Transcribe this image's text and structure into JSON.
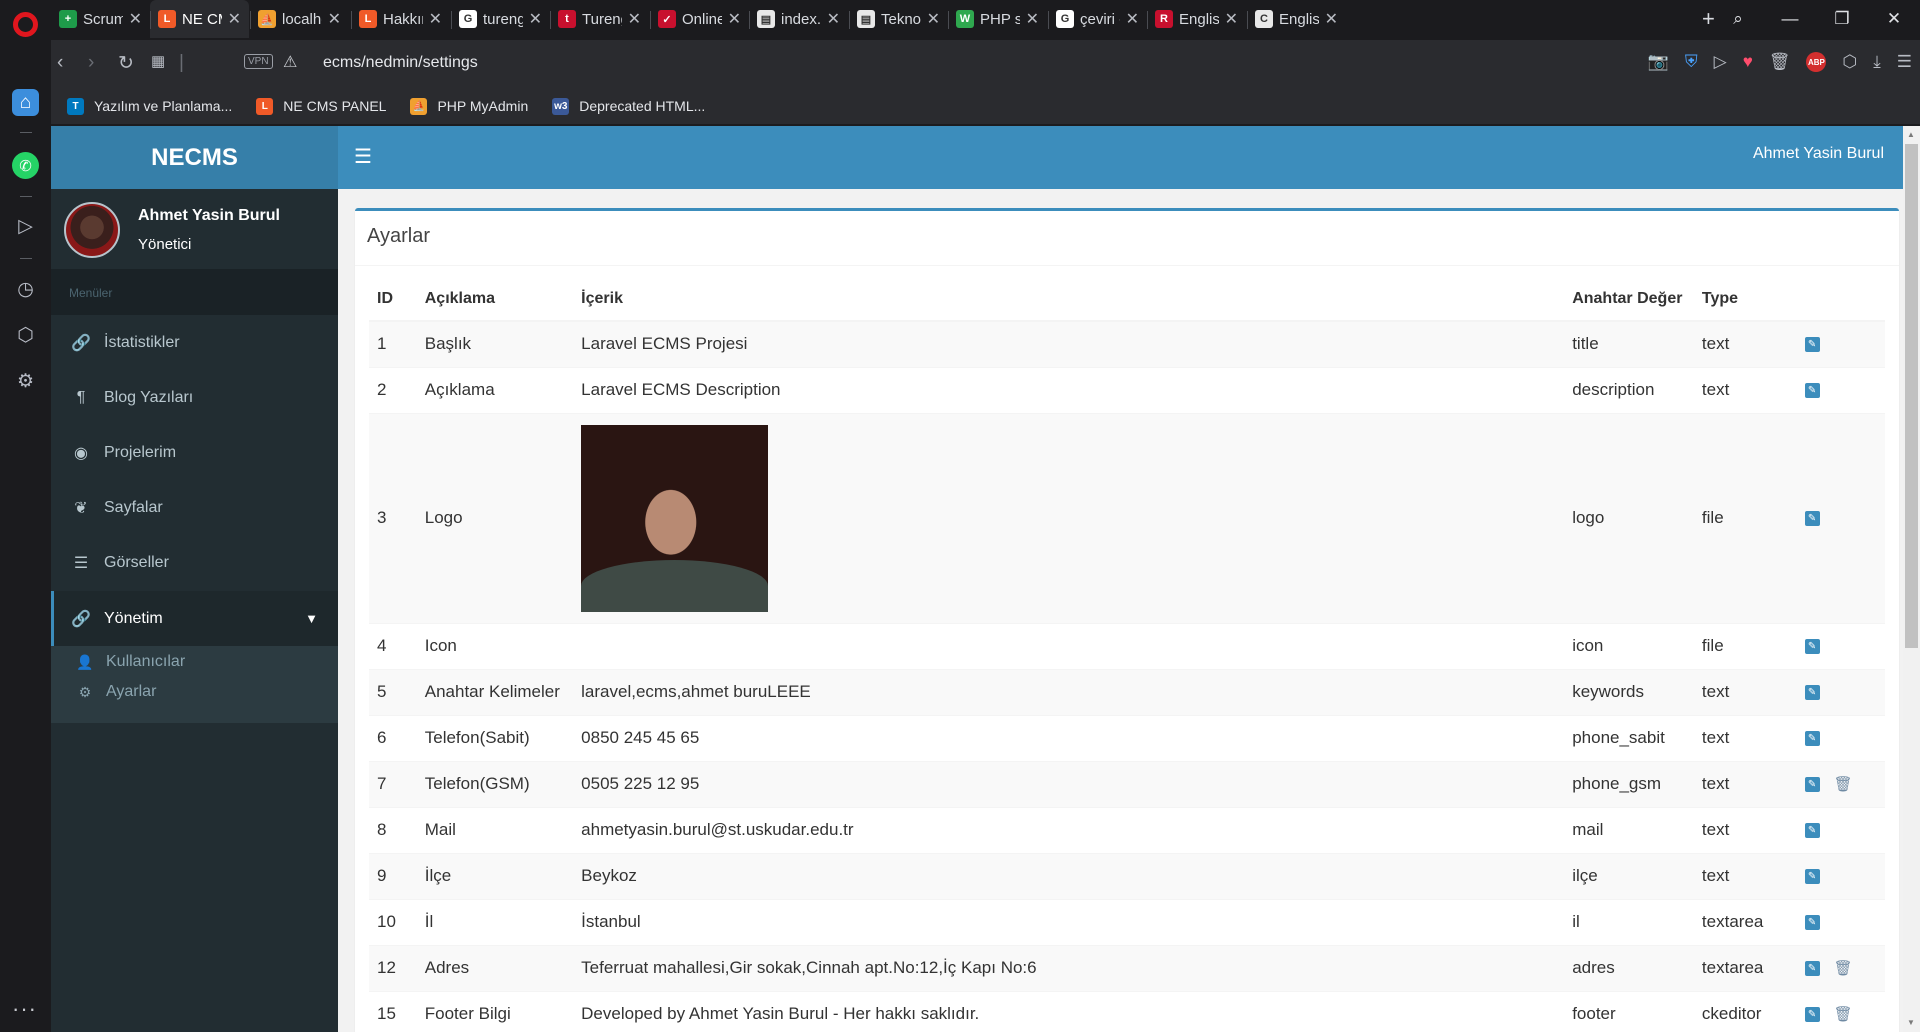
{
  "browser": {
    "tabs": [
      {
        "title": "ScrumPl",
        "color": "#1e9b4a",
        "glyph": "+"
      },
      {
        "title": "NE CMS",
        "color": "#f05a28",
        "glyph": "L",
        "active": true
      },
      {
        "title": "localhos",
        "color": "#f0a030",
        "glyph": "⛵"
      },
      {
        "title": "Hakkım",
        "color": "#f05a28",
        "glyph": "L"
      },
      {
        "title": "tureng",
        "color": "#ffffff",
        "glyph": "G"
      },
      {
        "title": "Tureng",
        "color": "#c8102e",
        "glyph": "t"
      },
      {
        "title": "Online",
        "color": "#c8102e",
        "glyph": "✓"
      },
      {
        "title": "index.bl",
        "color": "#e8e8e8",
        "glyph": "▤"
      },
      {
        "title": "Teknoloj",
        "color": "#e8e8e8",
        "glyph": "▤"
      },
      {
        "title": "PHP sub",
        "color": "#2fa84f",
        "glyph": "W"
      },
      {
        "title": "çeviri - (",
        "color": "#ffffff",
        "glyph": "G"
      },
      {
        "title": "English-",
        "color": "#c8102e",
        "glyph": "R"
      },
      {
        "title": "English",
        "color": "#e8e8e8",
        "glyph": "C"
      }
    ],
    "url": "ecms/nedmin/settings",
    "vpn_label": "VPN",
    "abp_label": "ABP",
    "bookmarks": [
      {
        "label": "Yazılım ve Planlama...",
        "color": "#0079bf",
        "glyph": "T"
      },
      {
        "label": "NE CMS PANEL",
        "color": "#f05a28",
        "glyph": "L"
      },
      {
        "label": "PHP MyAdmin",
        "color": "#f0a030",
        "glyph": "⛵"
      },
      {
        "label": "Deprecated HTML...",
        "color": "#3b5998",
        "glyph": "w3"
      }
    ]
  },
  "app": {
    "brand": "NECMS",
    "user_name": "Ahmet Yasin Burul",
    "user_role": "Yönetici",
    "menu_header": "Menüler",
    "menu": [
      {
        "label": "İstatistikler",
        "icon": "link-icon",
        "glyph": "🔗"
      },
      {
        "label": "Blog Yazıları",
        "icon": "paragraph-icon",
        "glyph": "¶"
      },
      {
        "label": "Projelerim",
        "icon": "github-icon",
        "glyph": "◉"
      },
      {
        "label": "Sayfalar",
        "icon": "leaf-icon",
        "glyph": "❦"
      },
      {
        "label": "Görseller",
        "icon": "sliders-icon",
        "glyph": "☰"
      },
      {
        "label": "Yönetim",
        "icon": "link-icon",
        "glyph": "🔗"
      }
    ],
    "submenu": [
      {
        "label": "Kullanıcılar",
        "icon": "user-icon",
        "glyph": "👤"
      },
      {
        "label": "Ayarlar",
        "icon": "gear-icon",
        "glyph": "⚙"
      }
    ],
    "top_user": "Ahmet Yasin Burul",
    "box_title": "Ayarlar",
    "columns": [
      "ID",
      "Açıklama",
      "İçerik",
      "Anahtar Değer",
      "Type"
    ],
    "rows": [
      {
        "id": "1",
        "desc": "Başlık",
        "content": "Laravel ECMS Projesi",
        "key": "title",
        "type": "text",
        "deletable": false
      },
      {
        "id": "2",
        "desc": "Açıklama",
        "content": "Laravel ECMS Description",
        "key": "description",
        "type": "text",
        "deletable": false
      },
      {
        "id": "3",
        "desc": "Logo",
        "content": "",
        "key": "logo",
        "type": "file",
        "deletable": false,
        "image": true
      },
      {
        "id": "4",
        "desc": "Icon",
        "content": "",
        "key": "icon",
        "type": "file",
        "deletable": false
      },
      {
        "id": "5",
        "desc": "Anahtar Kelimeler",
        "content": "laravel,ecms,ahmet buruLEEE",
        "key": "keywords",
        "type": "text",
        "deletable": false
      },
      {
        "id": "6",
        "desc": "Telefon(Sabit)",
        "content": "0850 245 45 65",
        "key": "phone_sabit",
        "type": "text",
        "deletable": false
      },
      {
        "id": "7",
        "desc": "Telefon(GSM)",
        "content": "0505 225 12 95",
        "key": "phone_gsm",
        "type": "text",
        "deletable": true
      },
      {
        "id": "8",
        "desc": "Mail",
        "content": "ahmetyasin.burul@st.uskudar.edu.tr",
        "key": "mail",
        "type": "text",
        "deletable": false
      },
      {
        "id": "9",
        "desc": "İlçe",
        "content": "Beykoz",
        "key": "ilçe",
        "type": "text",
        "deletable": false
      },
      {
        "id": "10",
        "desc": "İl",
        "content": "İstanbul",
        "key": "il",
        "type": "textarea",
        "deletable": false
      },
      {
        "id": "12",
        "desc": "Adres",
        "content": "Teferruat mahallesi,Gir sokak,Cinnah apt.No:12,İç Kapı No:6",
        "key": "adres",
        "type": "textarea",
        "deletable": true
      },
      {
        "id": "15",
        "desc": "Footer Bilgi",
        "content": "Developed by Ahmet Yasin Burul - Her hakkı saklıdır.",
        "key": "footer",
        "type": "ckeditor",
        "deletable": true
      }
    ]
  }
}
